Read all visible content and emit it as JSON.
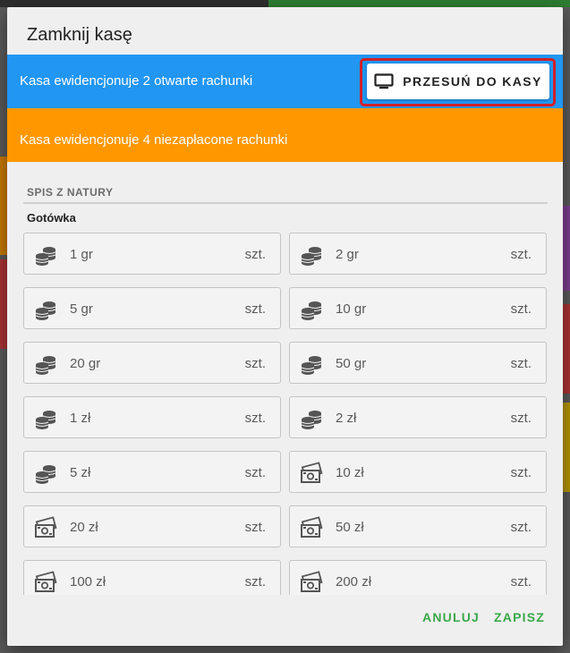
{
  "dialog": {
    "title": "Zamknij kasę"
  },
  "open_bills_banner": {
    "text": "Kasa ewidencjonuje 2 otwarte rachunki",
    "button_label": "PRZESUŃ DO KASY",
    "button_icon": "monitor-icon",
    "color": "#2196f3"
  },
  "unpaid_bills_banner": {
    "text": "Kasa ewidencjonuje 4 niezapłacone rachunki",
    "color": "#ff9800"
  },
  "inventory": {
    "section_title": "SPIS Z NATURY",
    "cash_label": "Gotówka",
    "denominations": [
      {
        "label": "1 gr",
        "unit": "szt.",
        "icon": "coins-icon"
      },
      {
        "label": "2 gr",
        "unit": "szt.",
        "icon": "coins-icon"
      },
      {
        "label": "5 gr",
        "unit": "szt.",
        "icon": "coins-icon"
      },
      {
        "label": "10 gr",
        "unit": "szt.",
        "icon": "coins-icon"
      },
      {
        "label": "20 gr",
        "unit": "szt.",
        "icon": "coins-icon"
      },
      {
        "label": "50 gr",
        "unit": "szt.",
        "icon": "coins-icon"
      },
      {
        "label": "1 zł",
        "unit": "szt.",
        "icon": "coins-icon"
      },
      {
        "label": "2 zł",
        "unit": "szt.",
        "icon": "coins-icon"
      },
      {
        "label": "5 zł",
        "unit": "szt.",
        "icon": "coins-icon"
      },
      {
        "label": "10 zł",
        "unit": "szt.",
        "icon": "banknotes-icon"
      },
      {
        "label": "20 zł",
        "unit": "szt.",
        "icon": "banknotes-icon"
      },
      {
        "label": "50 zł",
        "unit": "szt.",
        "icon": "banknotes-icon"
      },
      {
        "label": "100 zł",
        "unit": "szt.",
        "icon": "banknotes-icon"
      },
      {
        "label": "200 zł",
        "unit": "szt.",
        "icon": "banknotes-icon"
      }
    ]
  },
  "actions": {
    "cancel_label": "ANULUJ",
    "save_label": "ZAPISZ",
    "color": "#3aa84a"
  }
}
